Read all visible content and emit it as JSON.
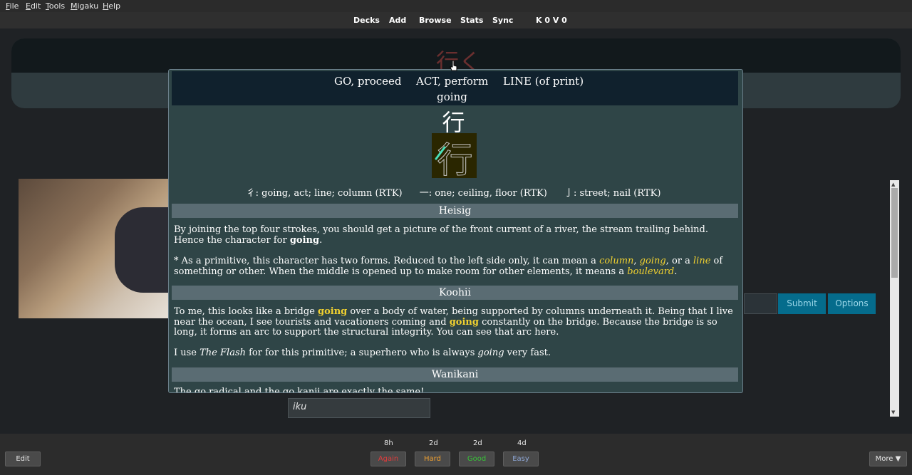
{
  "menu": {
    "file": {
      "letter": "F",
      "rest": "ile"
    },
    "edit": {
      "letter": "E",
      "rest": "dit"
    },
    "tools": {
      "letter": "T",
      "rest": "ools"
    },
    "migaku": {
      "letter": "M",
      "rest": "igaku"
    },
    "help": {
      "letter": "H",
      "rest": "elp"
    }
  },
  "nav": {
    "decks": "Decks",
    "add": "Add",
    "browse": "Browse",
    "stats": "Stats",
    "sync": "Sync",
    "counts": "K 0 V 0"
  },
  "background": {
    "card_kanji": "行く",
    "submit": "Submit",
    "options": "Options",
    "answer_input": "iku"
  },
  "popup": {
    "meanings": [
      "GO, proceed",
      "ACT, perform",
      "LINE (of print)"
    ],
    "keyword": "going",
    "kanji": "行",
    "stroke_kanji": "行",
    "components": [
      "彳: going, act; line; column (RTK)",
      "一: one; ceiling, floor (RTK)",
      "亅: street; nail (RTK)"
    ],
    "heisig": {
      "title": "Heisig",
      "p1_before": "By joining the top four strokes, you should get a picture of the front current of a river, the stream trailing behind. Hence the character for ",
      "p1_bold": "going",
      "p1_after": ".",
      "p2_a": "* As a primitive, this character has two forms. Reduced to the left side only, it can mean a ",
      "p2_w1": "column",
      "p2_b": ", ",
      "p2_w2": "going",
      "p2_c": ", or a ",
      "p2_w3": "line",
      "p2_d": " of something or other. When the middle is opened up to make room for other elements, it means a ",
      "p2_w4": "boulevard",
      "p2_e": "."
    },
    "koohii": {
      "title": "Koohii",
      "p1_a": "To me, this looks like a bridge ",
      "p1_w1": "going",
      "p1_b": " over a body of water, being supported by columns underneath it. Being that I live near the ocean, I see tourists and vacationers coming and ",
      "p1_w2": "going",
      "p1_c": " constantly on the bridge. Because the bridge is so long, it forms an arc to support the structural integrity. You can see that arc here.",
      "p2_a": "I use ",
      "p2_i1": "The Flash",
      "p2_b": " for for this primitive; a superhero who is always ",
      "p2_i2": "going",
      "p2_c": " very fast."
    },
    "wanikani": {
      "title": "Wanikani",
      "partial": "The go radical and the go kanji are exactly the same!"
    }
  },
  "bottom": {
    "edit": "Edit",
    "more": "More ▼",
    "answers": [
      {
        "interval": "8h",
        "label": "Again",
        "color": "#e03c3c"
      },
      {
        "interval": "2d",
        "label": "Hard",
        "color": "#f0a030"
      },
      {
        "interval": "2d",
        "label": "Good",
        "color": "#38c038"
      },
      {
        "interval": "4d",
        "label": "Easy",
        "color": "#8fa8d8"
      }
    ]
  }
}
